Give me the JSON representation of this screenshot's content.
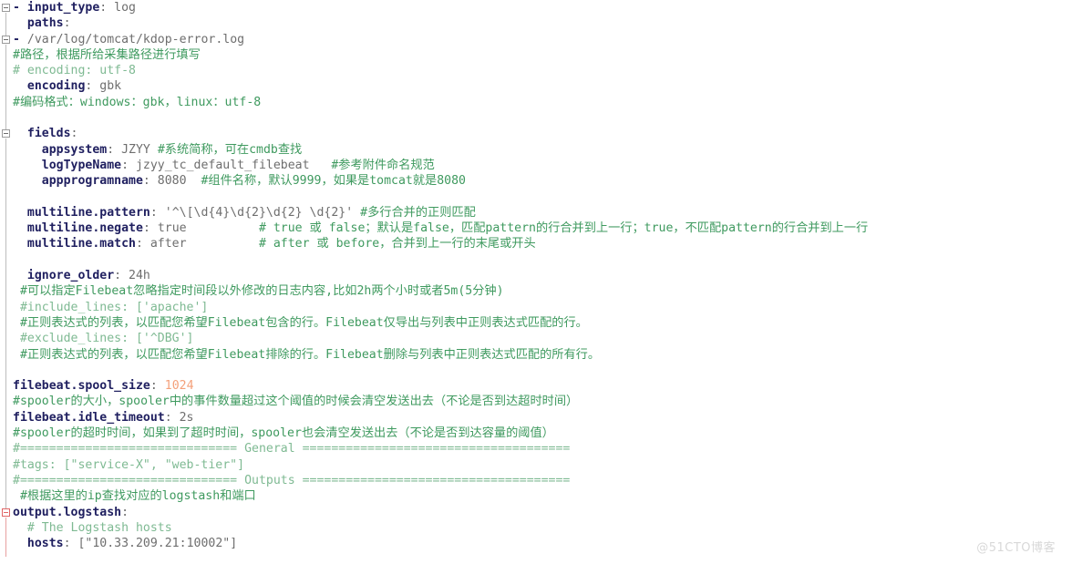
{
  "editor": {
    "app": "text-editor",
    "language": "yaml",
    "filename": "filebeat.yml",
    "colors": {
      "background": "#ffffff",
      "key": "#202060",
      "value": "#6e6e6e",
      "comment": "#3f9a5f",
      "comment_light": "#7fba93",
      "number": "#f4a07a",
      "fold_marker": "#9a9a9a",
      "fold_marker_active": "#e06666"
    }
  },
  "watermark": {
    "text": "@51CTO博客"
  },
  "fold_markers": [
    {
      "line": 0,
      "state": "expanded",
      "color": "#9a9a9a"
    },
    {
      "line": 2,
      "state": "expanded",
      "color": "#9a9a9a"
    },
    {
      "line": 8,
      "state": "expanded",
      "color": "#9a9a9a"
    },
    {
      "line": 32,
      "state": "expanded",
      "color": "#e06666"
    }
  ],
  "lines": [
    {
      "n": 0,
      "segs": [
        {
          "t": "p",
          "x": "- "
        },
        {
          "t": "k",
          "x": "input_type"
        },
        {
          "t": "v",
          "x": ": log"
        }
      ]
    },
    {
      "n": 1,
      "segs": [
        {
          "t": "v",
          "x": "  "
        },
        {
          "t": "k",
          "x": "paths"
        },
        {
          "t": "v",
          "x": ":"
        }
      ]
    },
    {
      "n": 2,
      "segs": [
        {
          "t": "p",
          "x": "- "
        },
        {
          "t": "v",
          "x": "/var/log/tomcat/kdop-error.log"
        }
      ]
    },
    {
      "n": 3,
      "segs": [
        {
          "t": "c",
          "x": "#路径，根据所给采集路径进行填写"
        }
      ]
    },
    {
      "n": 4,
      "segs": [
        {
          "t": "cg",
          "x": "# encoding: utf-8"
        }
      ]
    },
    {
      "n": 5,
      "segs": [
        {
          "t": "v",
          "x": "  "
        },
        {
          "t": "k",
          "x": "encoding"
        },
        {
          "t": "v",
          "x": ": gbk"
        }
      ]
    },
    {
      "n": 6,
      "segs": [
        {
          "t": "c",
          "x": "#编码格式：windows：gbk，linux：utf-8"
        }
      ]
    },
    {
      "n": 7,
      "segs": []
    },
    {
      "n": 8,
      "segs": [
        {
          "t": "v",
          "x": "  "
        },
        {
          "t": "k",
          "x": "fields"
        },
        {
          "t": "v",
          "x": ":"
        }
      ]
    },
    {
      "n": 9,
      "segs": [
        {
          "t": "v",
          "x": "    "
        },
        {
          "t": "k",
          "x": "appsystem"
        },
        {
          "t": "v",
          "x": ": JZYY "
        },
        {
          "t": "c",
          "x": "#系统简称，可在cmdb查找"
        }
      ]
    },
    {
      "n": 10,
      "segs": [
        {
          "t": "v",
          "x": "    "
        },
        {
          "t": "k",
          "x": "logTypeName"
        },
        {
          "t": "v",
          "x": ": jzyy_tc_default_filebeat   "
        },
        {
          "t": "c",
          "x": "#参考附件命名规范"
        }
      ]
    },
    {
      "n": 11,
      "segs": [
        {
          "t": "v",
          "x": "    "
        },
        {
          "t": "k",
          "x": "appprogramname"
        },
        {
          "t": "v",
          "x": ": 8080  "
        },
        {
          "t": "c",
          "x": "#组件名称，默认9999，如果是tomcat就是8080"
        }
      ]
    },
    {
      "n": 12,
      "segs": []
    },
    {
      "n": 13,
      "segs": [
        {
          "t": "v",
          "x": "  "
        },
        {
          "t": "k",
          "x": "multiline.pattern"
        },
        {
          "t": "v",
          "x": ": '^\\[\\d{4}\\d{2}\\d{2} \\d{2}' "
        },
        {
          "t": "c",
          "x": "#多行合并的正则匹配"
        }
      ]
    },
    {
      "n": 14,
      "segs": [
        {
          "t": "v",
          "x": "  "
        },
        {
          "t": "k",
          "x": "multiline.negate"
        },
        {
          "t": "v",
          "x": ": true          "
        },
        {
          "t": "c",
          "x": "# true 或 false；默认是false，匹配pattern的行合并到上一行；true，不匹配pattern的行合并到上一行"
        }
      ]
    },
    {
      "n": 15,
      "segs": [
        {
          "t": "v",
          "x": "  "
        },
        {
          "t": "k",
          "x": "multiline.match"
        },
        {
          "t": "v",
          "x": ": after          "
        },
        {
          "t": "c",
          "x": "# after 或 before，合并到上一行的末尾或开头"
        }
      ]
    },
    {
      "n": 16,
      "segs": []
    },
    {
      "n": 17,
      "segs": [
        {
          "t": "v",
          "x": "  "
        },
        {
          "t": "k",
          "x": "ignore_older"
        },
        {
          "t": "v",
          "x": ": 24h"
        }
      ]
    },
    {
      "n": 18,
      "segs": [
        {
          "t": "c",
          "x": " #可以指定Filebeat忽略指定时间段以外修改的日志内容,比如2h两个小时或者5m(5分钟)"
        }
      ]
    },
    {
      "n": 19,
      "segs": [
        {
          "t": "cg",
          "x": " #include_lines: ['apache']"
        }
      ]
    },
    {
      "n": 20,
      "segs": [
        {
          "t": "c",
          "x": " #正则表达式的列表，以匹配您希望Filebeat包含的行。Filebeat仅导出与列表中正则表达式匹配的行。"
        }
      ]
    },
    {
      "n": 21,
      "segs": [
        {
          "t": "cg",
          "x": " #exclude_lines: ['^DBG']"
        }
      ]
    },
    {
      "n": 22,
      "segs": [
        {
          "t": "c",
          "x": " #正则表达式的列表，以匹配您希望Filebeat排除的行。Filebeat删除与列表中正则表达式匹配的所有行。"
        }
      ]
    },
    {
      "n": 23,
      "segs": []
    },
    {
      "n": 24,
      "segs": [
        {
          "t": "k",
          "x": "filebeat.spool_size"
        },
        {
          "t": "v",
          "x": ": "
        },
        {
          "t": "num",
          "x": "1024"
        }
      ]
    },
    {
      "n": 25,
      "segs": [
        {
          "t": "c",
          "x": "#spooler的大小，spooler中的事件数量超过这个阈值的时候会清空发送出去（不论是否到达超时时间）"
        }
      ]
    },
    {
      "n": 26,
      "segs": [
        {
          "t": "k",
          "x": "filebeat.idle_timeout"
        },
        {
          "t": "v",
          "x": ": 2s"
        }
      ]
    },
    {
      "n": 27,
      "segs": [
        {
          "t": "c",
          "x": "#spooler的超时时间，如果到了超时时间，spooler也会清空发送出去（不论是否到达容量的阈值）"
        }
      ]
    },
    {
      "n": 28,
      "segs": [
        {
          "t": "cg",
          "x": "#============================== General ====================================="
        }
      ]
    },
    {
      "n": 29,
      "segs": [
        {
          "t": "cg",
          "x": "#tags: [\"service-X\", \"web-tier\"]"
        }
      ]
    },
    {
      "n": 30,
      "segs": [
        {
          "t": "cg",
          "x": "#============================== Outputs ====================================="
        }
      ]
    },
    {
      "n": 31,
      "segs": [
        {
          "t": "c",
          "x": " #根据这里的ip查找对应的logstash和端口"
        }
      ]
    },
    {
      "n": 32,
      "segs": [
        {
          "t": "k",
          "x": "output.logstash"
        },
        {
          "t": "v",
          "x": ":"
        }
      ]
    },
    {
      "n": 33,
      "segs": [
        {
          "t": "cg",
          "x": "  # The Logstash hosts"
        }
      ]
    },
    {
      "n": 34,
      "segs": [
        {
          "t": "v",
          "x": "  "
        },
        {
          "t": "k",
          "x": "hosts"
        },
        {
          "t": "v",
          "x": ": [\"10.33.209.21:10002\"]"
        }
      ]
    }
  ]
}
